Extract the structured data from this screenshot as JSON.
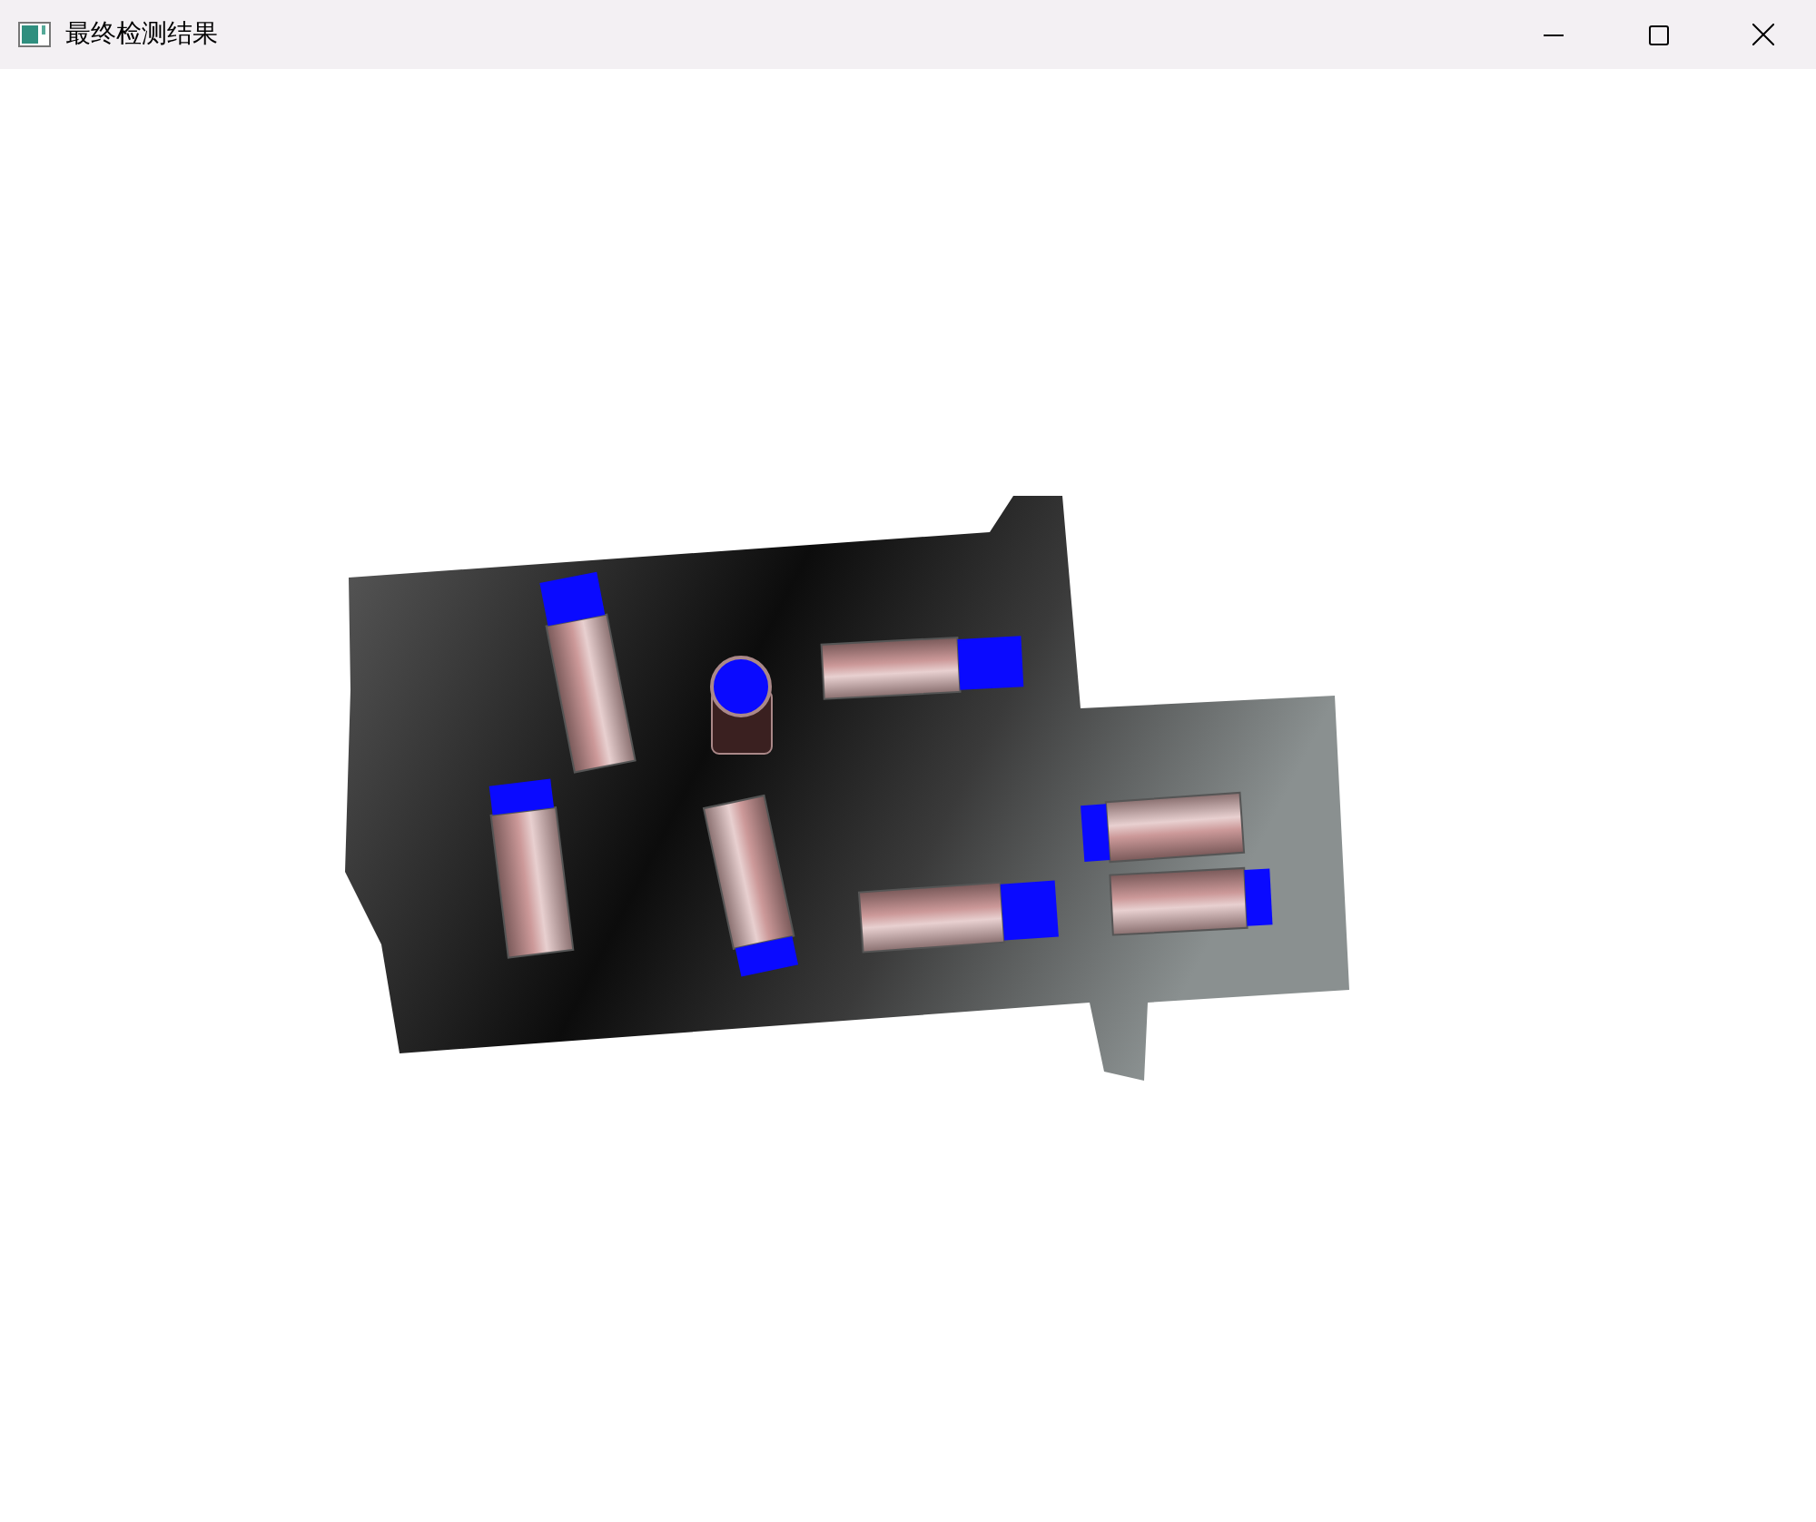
{
  "window": {
    "title": "最终检测结果"
  }
}
